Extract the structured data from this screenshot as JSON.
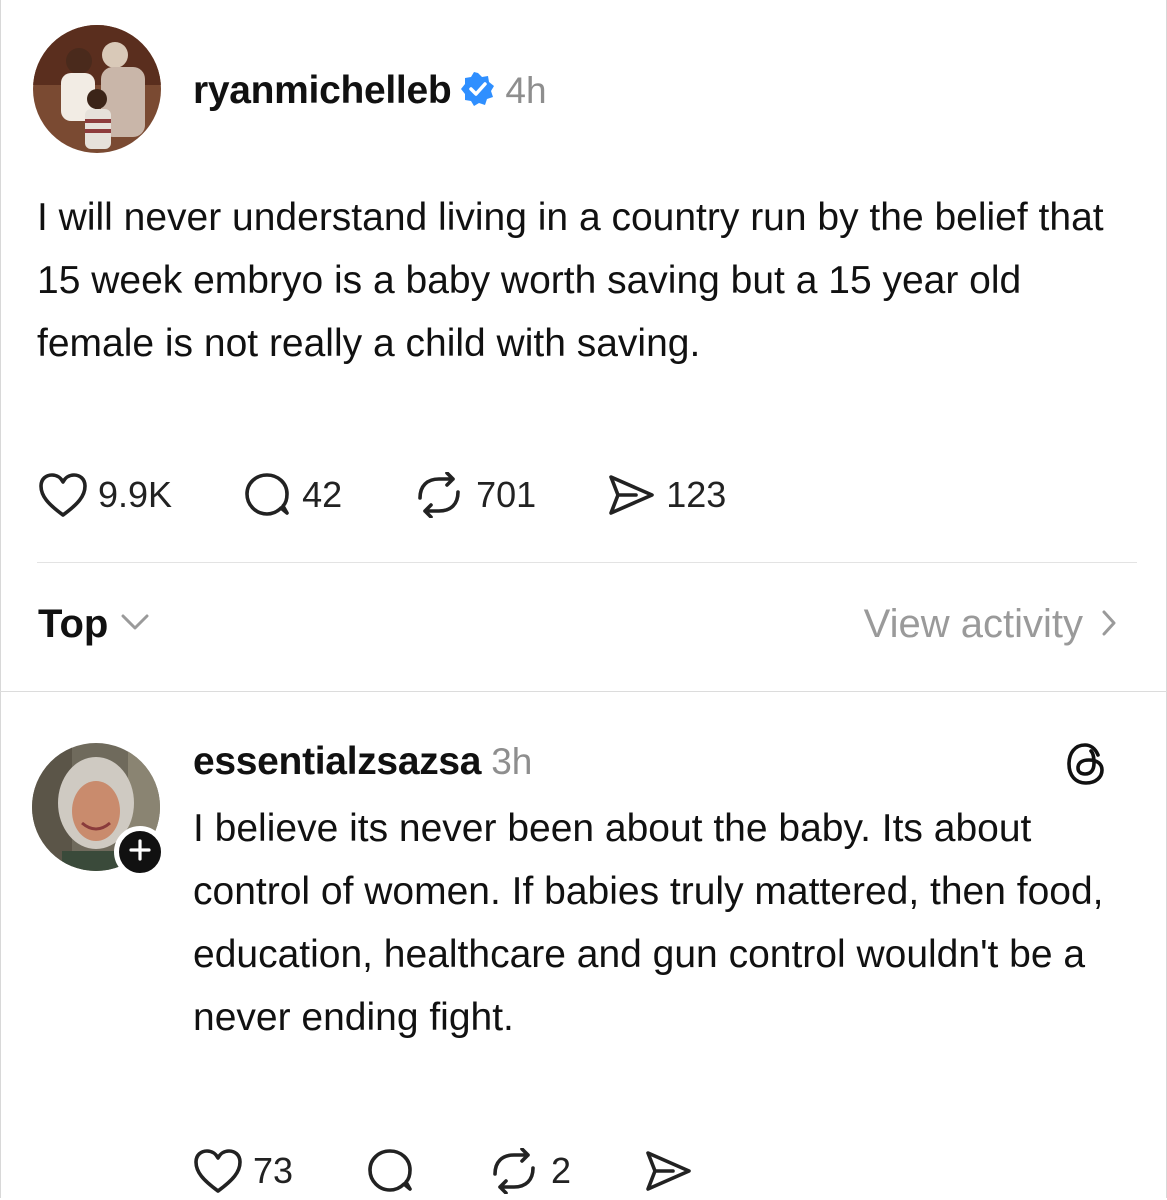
{
  "post": {
    "username": "ryanmichelleb",
    "verified": true,
    "time": "4h",
    "text": "I will never understand living in a country run by the belief that 15 week embryo is a baby worth saving but a 15 year old female is not really a child with saving.",
    "stats": {
      "likes": "9.9K",
      "replies": "42",
      "reposts": "701",
      "shares": "123"
    }
  },
  "sort": {
    "label": "Top",
    "view_activity": "View activity"
  },
  "reply": {
    "username": "essentialzsazsa",
    "time": "3h",
    "text": "I believe its never been about the baby. Its about control of women. If babies truly mattered, then food, education, healthcare and gun control wouldn't be a never ending fight.",
    "stats": {
      "likes": "73",
      "reposts": "2"
    }
  },
  "colors": {
    "verified_badge": "#2f8fff",
    "muted_text": "#8e8e8e",
    "divider": "#e3e3e3"
  },
  "icons": [
    "verified-badge-icon",
    "heart-icon",
    "comment-icon",
    "repost-icon",
    "share-icon",
    "chevron-down-icon",
    "chevron-right-icon",
    "threads-logo-icon",
    "plus-icon"
  ]
}
